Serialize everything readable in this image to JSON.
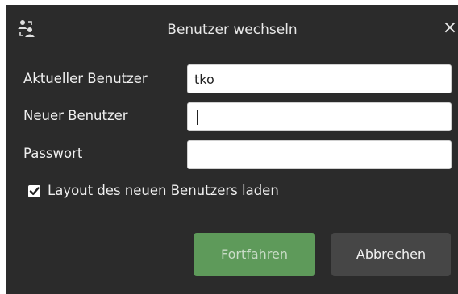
{
  "dialog": {
    "title": "Benutzer wechseln",
    "title_icon": "switch-user-icon",
    "close_glyph": "×"
  },
  "form": {
    "current_user_label": "Aktueller Benutzer",
    "current_user_value": "tko",
    "new_user_label": "Neuer Benutzer",
    "new_user_value": "",
    "password_label": "Passwort",
    "password_value": ""
  },
  "options": {
    "load_layout_label": "Layout des neuen Benutzers laden",
    "load_layout_checked": true
  },
  "buttons": {
    "continue_label": "Fortfahren",
    "cancel_label": "Abbrechen"
  },
  "colors": {
    "dialog_background": "#2b2b2b",
    "primary_button": "#5e9a5a",
    "secondary_button": "#464646"
  }
}
